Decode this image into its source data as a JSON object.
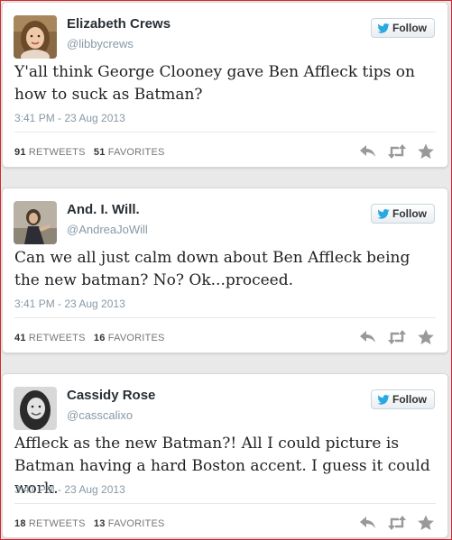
{
  "follow_label": "Follow",
  "tweets": [
    {
      "name": "Elizabeth Crews",
      "handle": "@libbycrews",
      "text": "Y'all think George Clooney gave Ben Affleck tips on how to suck as Batman?",
      "timestamp": "3:41 PM - 23 Aug 2013",
      "retweets": "91",
      "retweets_label": "RETWEETS",
      "favorites": "51",
      "favorites_label": "FAVORITES"
    },
    {
      "name": "And. I. Will.",
      "handle": "@AndreaJoWill",
      "text": "Can we all just calm down about Ben Affleck being the new batman? No? Ok...proceed.",
      "timestamp": "3:41 PM - 23 Aug 2013",
      "retweets": "41",
      "retweets_label": "RETWEETS",
      "favorites": "16",
      "favorites_label": "FAVORITES"
    },
    {
      "name": "Cassidy Rose",
      "handle": "@casscalixo",
      "text": "Affleck as the new Batman?! All I could picture is Batman having a hard Boston accent. I guess it could work.",
      "timestamp": "3:41 PM - 23 Aug 2013",
      "retweets": "18",
      "retweets_label": "RETWEETS",
      "favorites": "13",
      "favorites_label": "FAVORITES"
    }
  ],
  "colors": {
    "twitter_blue": "#2aa9e0",
    "action_gray": "#999999",
    "border_red": "#d9262a"
  },
  "icons": [
    "twitter-bird-icon",
    "reply-icon",
    "retweet-icon",
    "favorite-star-icon"
  ]
}
